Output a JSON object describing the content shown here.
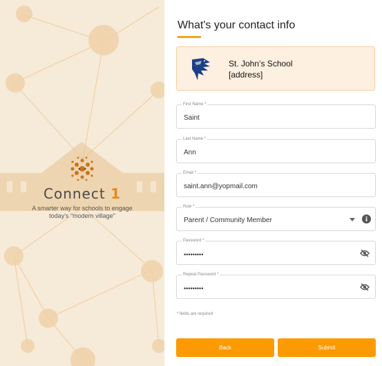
{
  "brand": {
    "name": "Connect",
    "number": "1",
    "tagline_line1": "A smarter way for schools to engage",
    "tagline_line2": "today's \"modern village\"",
    "accent_color": "#e8871f"
  },
  "form": {
    "title": "What's your contact info",
    "school": {
      "name": "St. John’s School",
      "address": "[address]"
    },
    "fields": {
      "first_name": {
        "label": "First Name *",
        "value": "Saint"
      },
      "last_name": {
        "label": "Last Name *",
        "value": "Ann"
      },
      "email": {
        "label": "Email *",
        "value": "saint.ann@yopmail.com"
      },
      "role": {
        "label": "Role *",
        "value": "Parent / Community Member"
      },
      "password": {
        "label": "Password *",
        "value": "•••••••••"
      },
      "repeat_password": {
        "label": "Repeat Password *",
        "value": "•••••••••"
      }
    },
    "required_note": "* fields are required",
    "back_label": "Back",
    "submit_label": "Submit",
    "button_color": "#fc9a04"
  },
  "icons": {
    "role_dropdown": "chevron-down-icon",
    "role_info": "info-icon",
    "password_visibility": "eye-off-icon"
  }
}
